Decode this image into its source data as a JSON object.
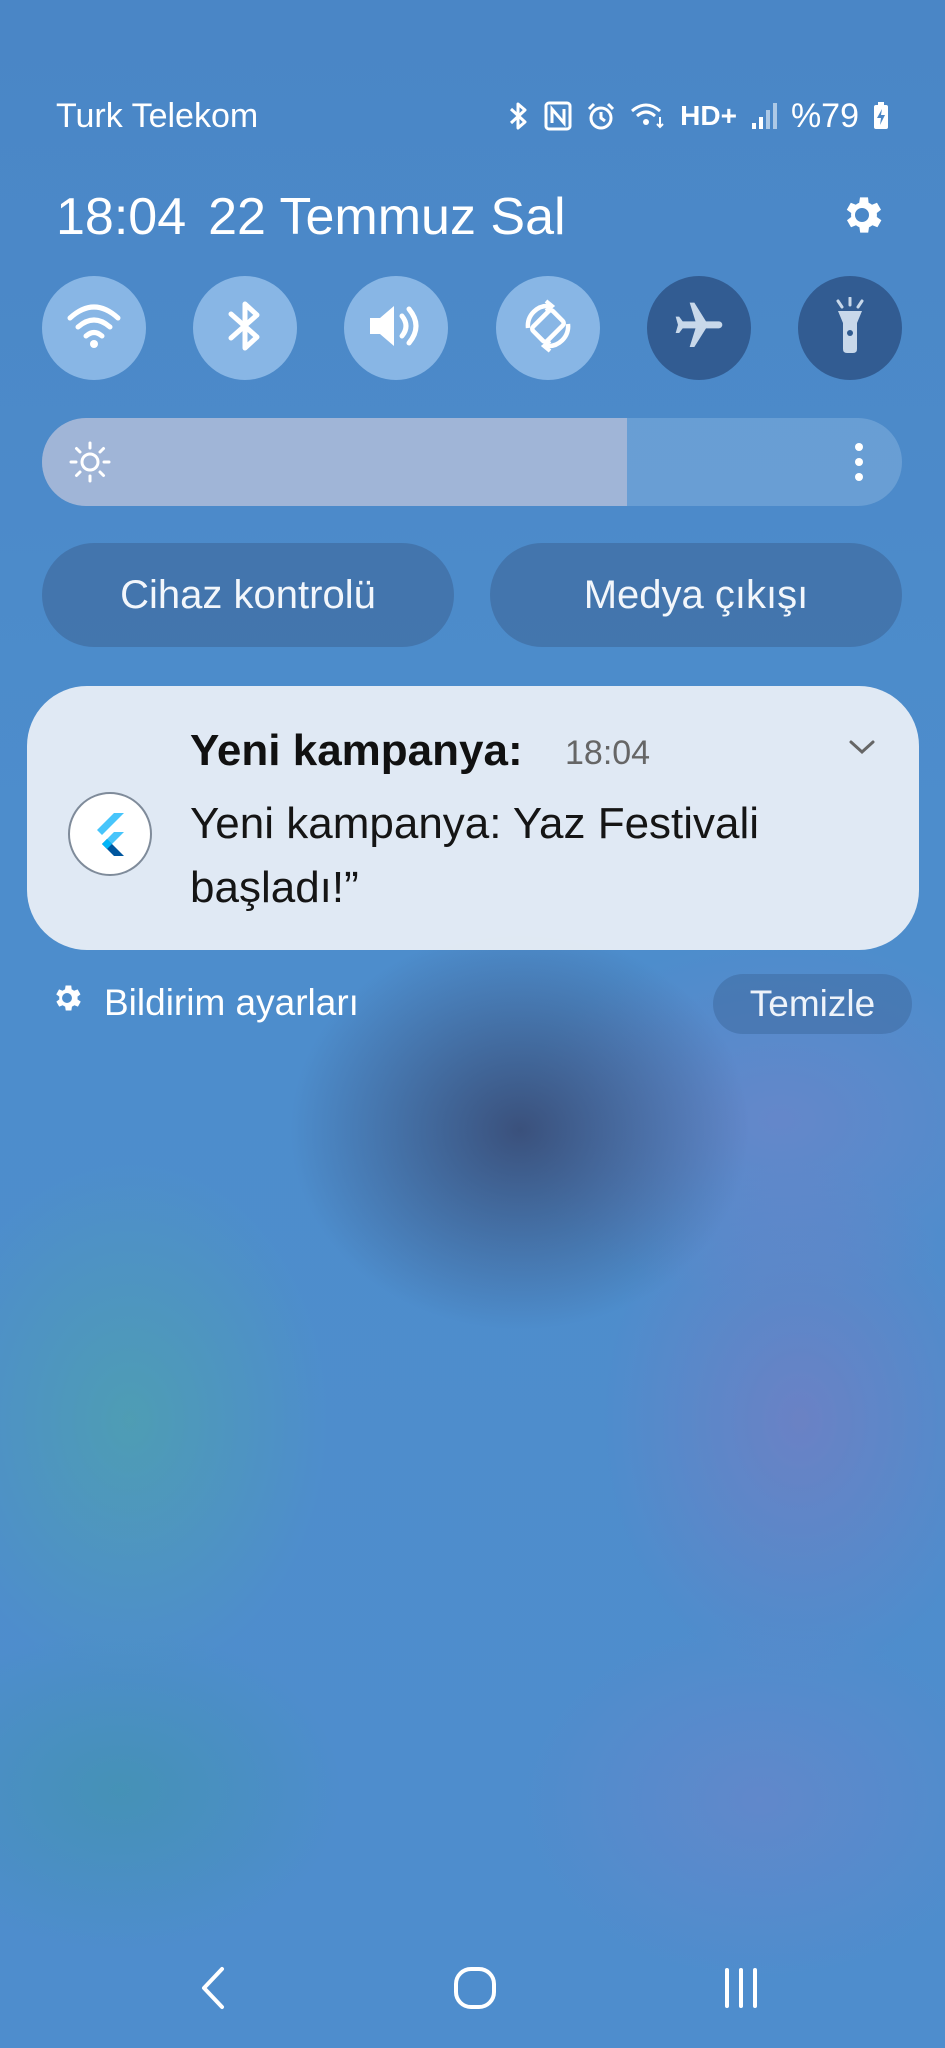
{
  "status_bar": {
    "carrier": "Turk Telekom",
    "network_label": "HD+",
    "battery": "%79",
    "icons": [
      "bluetooth-icon",
      "nfc-icon",
      "alarm-icon",
      "wifi-call-icon",
      "hd-voice-icon",
      "signal-icon",
      "battery-charging-icon"
    ]
  },
  "header": {
    "time": "18:04",
    "date": "22 Temmuz Sal",
    "settings_icon": "gear-icon"
  },
  "quick_tiles": [
    {
      "name": "wifi",
      "icon": "wifi-icon",
      "state": "on"
    },
    {
      "name": "bluetooth",
      "icon": "bluetooth-icon",
      "state": "on"
    },
    {
      "name": "sound",
      "icon": "volume-icon",
      "state": "on"
    },
    {
      "name": "auto-rotate",
      "icon": "rotate-icon",
      "state": "on"
    },
    {
      "name": "airplane-mode",
      "icon": "airplane-icon",
      "state": "off"
    },
    {
      "name": "flashlight",
      "icon": "flashlight-icon",
      "state": "off"
    }
  ],
  "brightness": {
    "level": 0.68,
    "icon": "sun-icon",
    "more_icon": "more-vertical-icon"
  },
  "controls": {
    "device_control": "Cihaz kontrolü",
    "media_output": "Medya çıkışı"
  },
  "notification": {
    "app_icon": "flutter-logo-icon",
    "title": "Yeni kampanya:",
    "time": "18:04",
    "body": "Yeni kampanya: Yaz Festivali başladı!”"
  },
  "footer": {
    "settings_label": "Bildirim ayarları",
    "clear_label": "Temizle"
  },
  "nav": {
    "icons": [
      "recent-apps-icon",
      "home-icon",
      "back-icon"
    ]
  },
  "colors": {
    "tile_on": "#a0c8f0",
    "tile_off": "#284b7d",
    "notification_bg": "#e8eef6"
  }
}
